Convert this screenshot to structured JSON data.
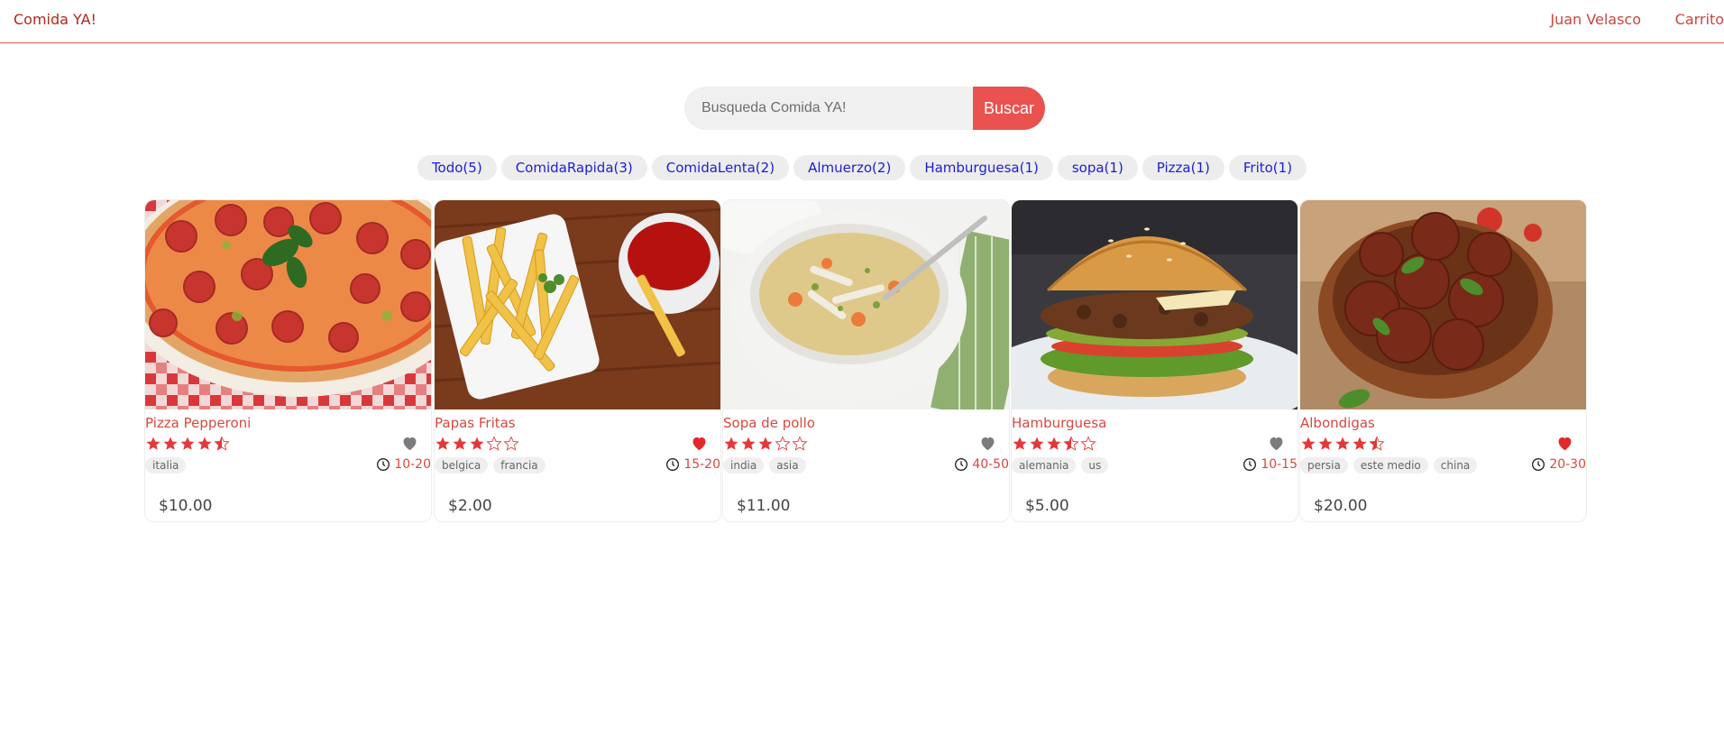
{
  "header": {
    "brand": "Comida YA!",
    "user": "Juan Velasco",
    "cart": "Carrito",
    "accent_color": "#e8534f"
  },
  "search": {
    "placeholder": "Busqueda Comida YA!",
    "button": "Buscar"
  },
  "categories": [
    "Todo(5)",
    "ComidaRapida(3)",
    "ComidaLenta(2)",
    "Almuerzo(2)",
    "Hamburguesa(1)",
    "sopa(1)",
    "Pizza(1)",
    "Frito(1)"
  ],
  "products": [
    {
      "name": "Pizza Pepperoni",
      "rating": 4.5,
      "favorite": false,
      "tags": [
        "italia"
      ],
      "time": "10-20",
      "price": "$10.00",
      "image": "pizza-photo"
    },
    {
      "name": "Papas Fritas",
      "rating": 3,
      "favorite": true,
      "tags": [
        "belgica",
        "francia"
      ],
      "time": "15-20",
      "price": "$2.00",
      "image": "fries-photo"
    },
    {
      "name": "Sopa de pollo",
      "rating": 3,
      "favorite": false,
      "tags": [
        "india",
        "asia"
      ],
      "time": "40-50",
      "price": "$11.00",
      "image": "soup-photo"
    },
    {
      "name": "Hamburguesa",
      "rating": 3.5,
      "favorite": false,
      "tags": [
        "alemania",
        "us"
      ],
      "time": "10-15",
      "price": "$5.00",
      "image": "burger-photo"
    },
    {
      "name": "Albondigas",
      "rating": 4.5,
      "favorite": true,
      "tags": [
        "persia",
        "este medio",
        "china"
      ],
      "time": "20-30",
      "price": "$20.00",
      "image": "meatballs-photo"
    }
  ]
}
